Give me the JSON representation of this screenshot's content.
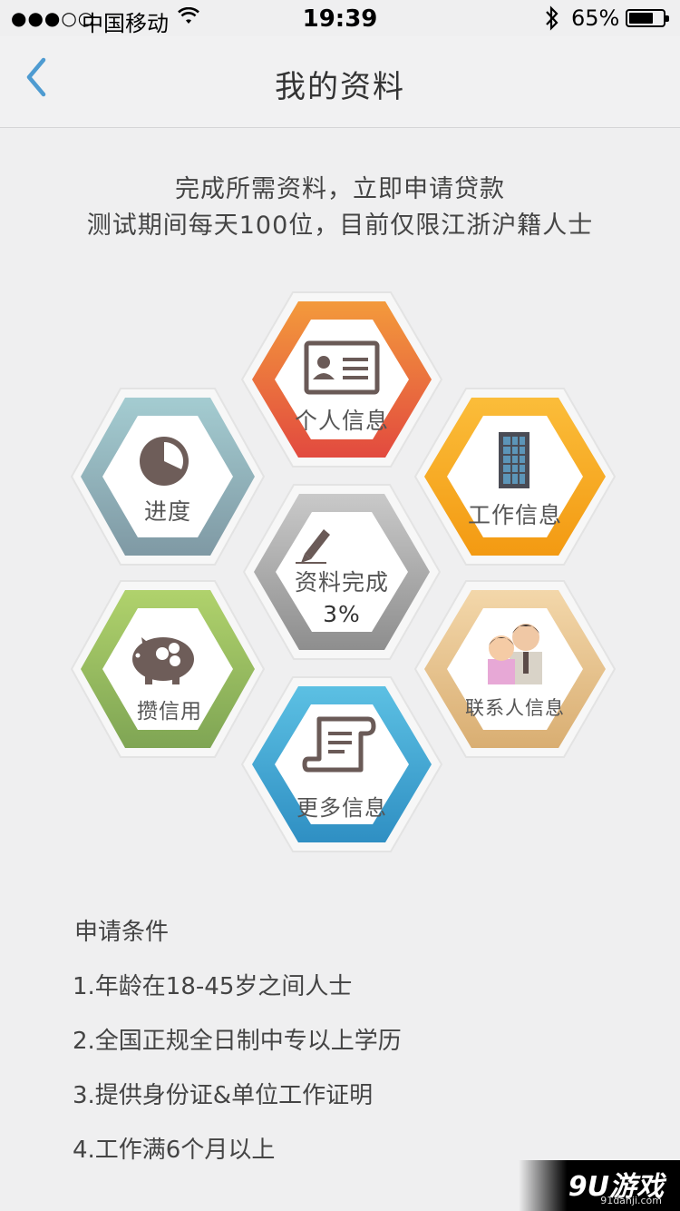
{
  "status_bar": {
    "signal": "●●●○○",
    "carrier": "中国移动",
    "time": "19:39",
    "battery": "65%",
    "battery_level": 0.65
  },
  "nav": {
    "back_icon": "chevron-left-icon",
    "title": "我的资料"
  },
  "intro": {
    "line1": "完成所需资料，立即申请贷款",
    "line2": "测试期间每天100位，目前仅限江浙沪籍人士"
  },
  "hexes": {
    "personal": {
      "label": "个人信息",
      "icon": "id-card-icon",
      "color": "#e9663c"
    },
    "progress": {
      "label": "进度",
      "icon": "pie-chart-icon",
      "color": "#8fb3ba"
    },
    "work": {
      "label": "工作信息",
      "icon": "building-icon",
      "color": "#f6a22a"
    },
    "center": {
      "label": "资料完成",
      "value": "3%",
      "icon": "pencil-icon",
      "color": "#a6a6a6"
    },
    "credit": {
      "label": "攒信用",
      "icon": "piggy-bank-icon",
      "color": "#93bd5e"
    },
    "contacts": {
      "label": "联系人信息",
      "icon": "people-icon",
      "color": "#e7c28c"
    },
    "more": {
      "label": "更多信息",
      "icon": "document-icon",
      "color": "#3ba4d3"
    }
  },
  "conditions": {
    "title": "申请条件",
    "items": [
      "1.年龄在18-45岁之间人士",
      "2.全国正规全日制中专以上学历",
      "3.提供身份证&单位工作证明",
      "4.工作满6个月以上"
    ]
  },
  "watermark": {
    "text": "9U游戏",
    "sub": "91danji.com"
  }
}
